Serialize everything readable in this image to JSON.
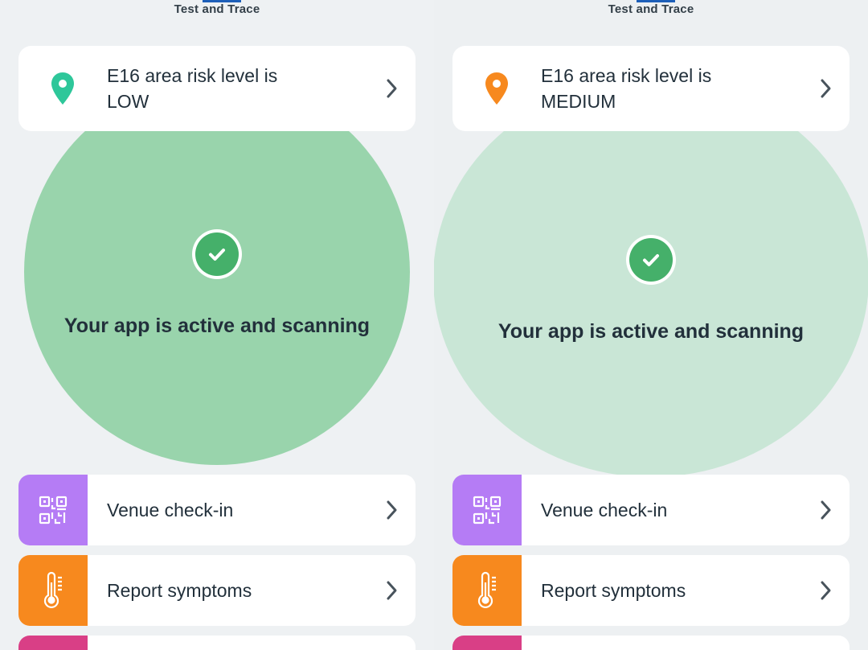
{
  "panels": [
    {
      "brand": "Test and Trace",
      "risk": {
        "line1": "E16 area risk level is",
        "line2": "LOW",
        "pin_color": "#2ec79a"
      },
      "status": "Your app is active and scanning",
      "menu": [
        {
          "label": "Venue check-in",
          "icon": "qr-code-icon",
          "color": "#b57cf5"
        },
        {
          "label": "Report symptoms",
          "icon": "thermometer-icon",
          "color": "#f7891e"
        }
      ]
    },
    {
      "brand": "Test and Trace",
      "risk": {
        "line1": "E16 area risk level is",
        "line2": "MEDIUM",
        "pin_color": "#f7891e"
      },
      "status": "Your app is active and scanning",
      "menu": [
        {
          "label": "Venue check-in",
          "icon": "qr-code-icon",
          "color": "#b57cf5"
        },
        {
          "label": "Report symptoms",
          "icon": "thermometer-icon",
          "color": "#f7891e"
        }
      ]
    }
  ]
}
